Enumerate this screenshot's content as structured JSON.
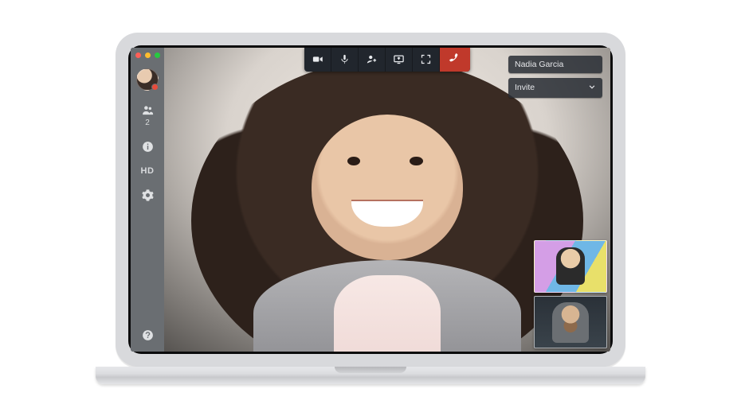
{
  "call": {
    "active_speaker_name": "Nadia Garcia",
    "invite_label": "Invite",
    "participant_count": "2",
    "hd_label": "HD"
  },
  "sidebar": {
    "people_icon": "people-icon",
    "info_icon": "info-icon",
    "settings_icon": "gear-icon",
    "help_icon": "help-icon"
  },
  "toolbar": {
    "camera": "camera-icon",
    "mic": "mic-icon",
    "add_person": "add-person-icon",
    "screen_share": "screen-share-icon",
    "fullscreen": "fullscreen-icon",
    "end_call": "end-call-icon"
  }
}
